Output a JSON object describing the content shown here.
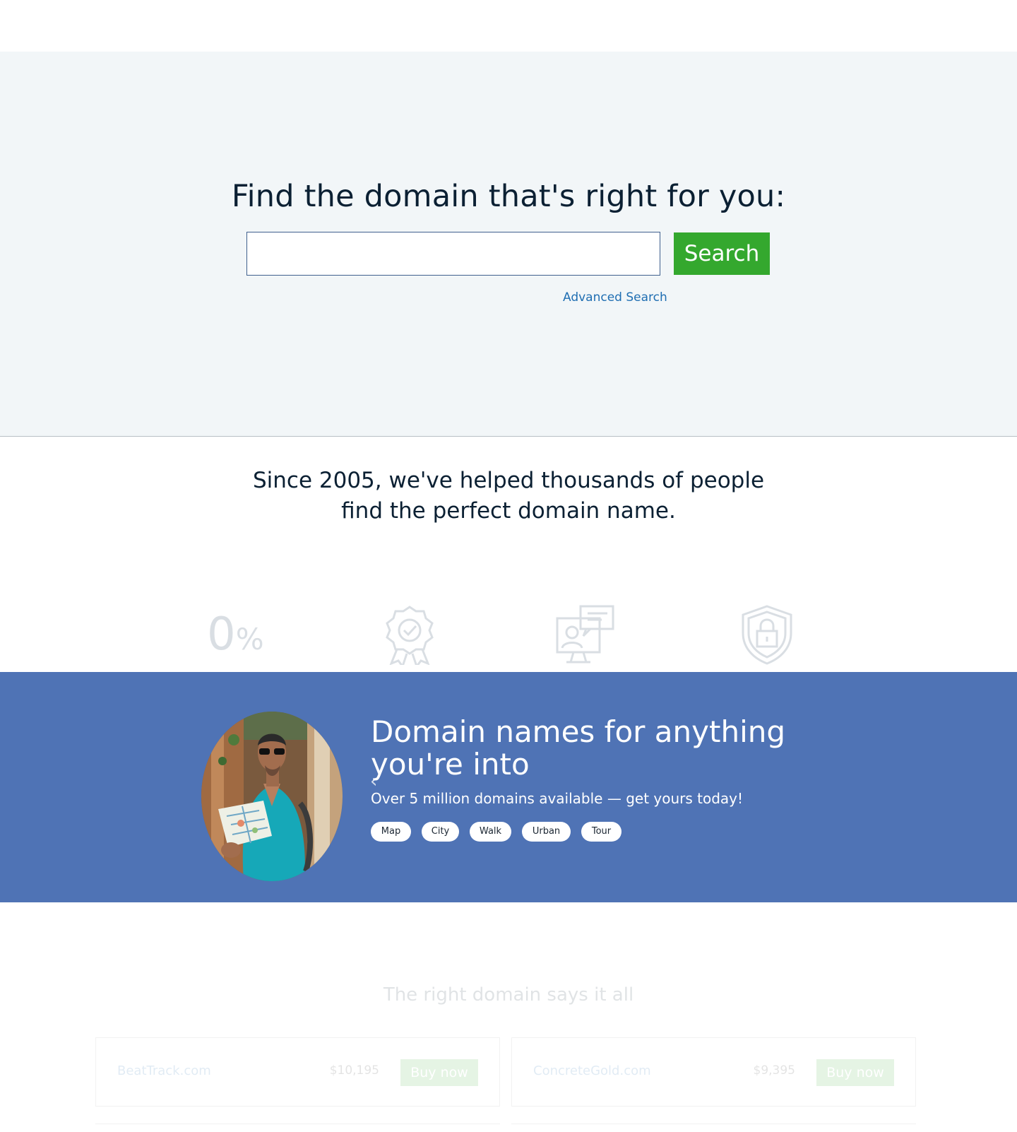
{
  "hero": {
    "title": "Find the domain that's right for you:",
    "search_placeholder": "",
    "search_value": "",
    "search_button": "Search",
    "advanced_search": "Advanced Search"
  },
  "intro": {
    "line1": "Since 2005, we've helped thousands of people",
    "line2": "find the perfect domain name."
  },
  "features": {
    "icons": [
      "zero-percent-icon",
      "award-ribbon-icon",
      "computer-support-icon",
      "security-shield-lock-icon"
    ],
    "zero_digit": "0",
    "zero_percent": "%"
  },
  "banner": {
    "title": "Domain names for anything you're into",
    "subtitle": "Over 5 million domains available — get yours today!",
    "prev_arrow": "‹",
    "tags": [
      "Map",
      "City",
      "Walk",
      "Urban",
      "Tour"
    ],
    "background_color": "#4f73b5"
  },
  "listings": {
    "heading": "The right domain says it all",
    "items": [
      {
        "name": "BeatTrack.com",
        "price": "$10,195",
        "buy": "Buy now"
      },
      {
        "name": "ConcreteGold.com",
        "price": "$9,395",
        "buy": "Buy now"
      }
    ]
  },
  "colors": {
    "accent_green": "#34a82e",
    "link_blue": "#1f6eb2",
    "hero_bg": "#f2f6f8"
  }
}
